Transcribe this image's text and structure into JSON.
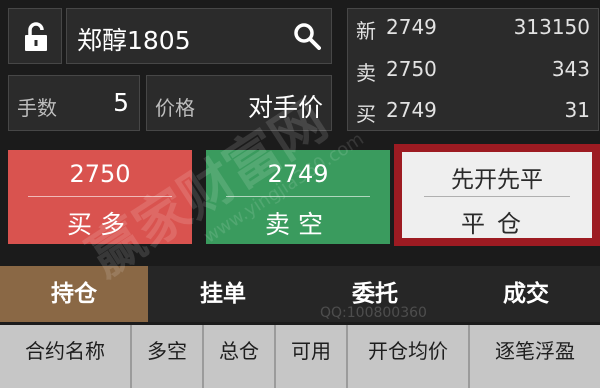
{
  "contract": {
    "name": "郑醇1805"
  },
  "quantity": {
    "label": "手数",
    "value": "5"
  },
  "price": {
    "label": "价格",
    "value": "对手价"
  },
  "quote": {
    "rows": [
      {
        "key": "新",
        "price": "2749",
        "volume": "313150"
      },
      {
        "key": "卖",
        "price": "2750",
        "volume": "343"
      },
      {
        "key": "买",
        "price": "2749",
        "volume": "31"
      }
    ]
  },
  "buy": {
    "price": "2750",
    "action": "买多"
  },
  "sell": {
    "price": "2749",
    "action": "卖空"
  },
  "close": {
    "mode": "先开先平",
    "action": "平仓"
  },
  "tabs": [
    {
      "label": "持仓",
      "active": true
    },
    {
      "label": "挂单",
      "active": false
    },
    {
      "label": "委托",
      "active": false
    },
    {
      "label": "成交",
      "active": false
    }
  ],
  "columns": [
    "合约名称",
    "多空",
    "总仓",
    "可用",
    "开仓均价",
    "逐笔浮盈"
  ],
  "watermark": {
    "brand": "赢家财富网",
    "site": "www.yingjia360.com",
    "qq": "QQ:100800360"
  },
  "icons": {
    "lock": "lock-open-icon",
    "search": "search-icon"
  },
  "colors": {
    "buy": "#d9534f",
    "sell": "#3a9b5e",
    "close_border": "#9d1b22",
    "active_tab": "#8a6845"
  }
}
